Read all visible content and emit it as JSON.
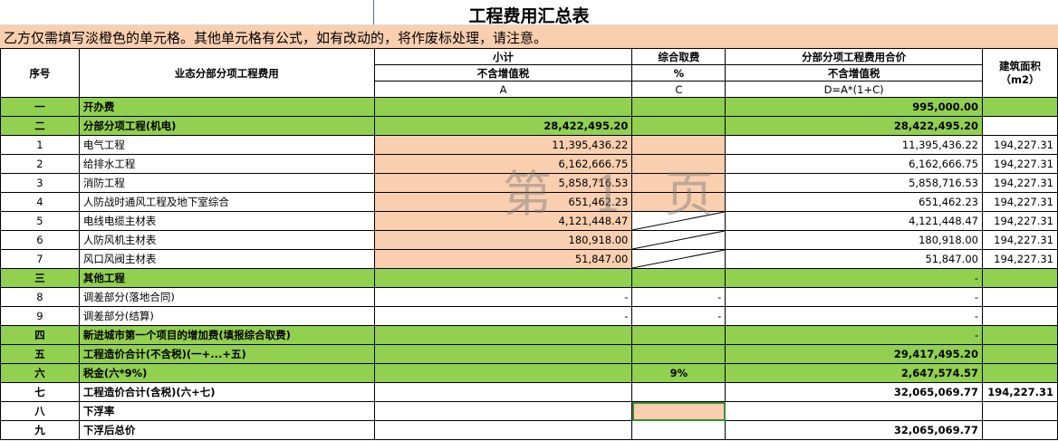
{
  "sheet": {
    "title": "工程费用汇总表",
    "notice": "乙方仅需填写淡橙色的单元格。其他单元格有公式，如有改动的，将作废标处理，请注意。",
    "watermark": "第 1 页"
  },
  "header": {
    "col_no": "序号",
    "col_name": "业态分部分项工程费用",
    "col_subtotal": "小计",
    "col_subtotal_sub": "不含增值税",
    "col_subtotal_letter": "A",
    "col_fee": "综合取费",
    "col_fee_unit": "%",
    "col_fee_letter": "C",
    "col_total": "分部分项工程费用合价",
    "col_total_sub": "不含增值税",
    "col_total_formula": "D=A*(1+C)",
    "col_area": "建筑面积",
    "col_area_unit": "（m2）"
  },
  "rows": [
    {
      "no": "一",
      "name": "开办费",
      "a": "",
      "c": "",
      "d": "995,000.00",
      "area": ""
    },
    {
      "no": "二",
      "name": "分部分项工程(机电)",
      "a": "28,422,495.20",
      "c": "",
      "d": "28,422,495.20",
      "area": ""
    },
    {
      "no": "1",
      "name": "电气工程",
      "a": "11,395,436.22",
      "c": "",
      "d": "11,395,436.22",
      "area": "194,227.31"
    },
    {
      "no": "2",
      "name": "给排水工程",
      "a": "6,162,666.75",
      "c": "",
      "d": "6,162,666.75",
      "area": "194,227.31"
    },
    {
      "no": "3",
      "name": "消防工程",
      "a": "5,858,716.53",
      "c": "",
      "d": "5,858,716.53",
      "area": "194,227.31"
    },
    {
      "no": "4",
      "name": "人防战时通风工程及地下室综合",
      "a": "651,462.23",
      "c": "",
      "d": "651,462.23",
      "area": "194,227.31"
    },
    {
      "no": "5",
      "name": "电线电缆主材表",
      "a": "4,121,448.47",
      "c": "",
      "d": "4,121,448.47",
      "area": "194,227.31"
    },
    {
      "no": "6",
      "name": "人防风机主材表",
      "a": "180,918.00",
      "c": "",
      "d": "180,918.00",
      "area": "194,227.31"
    },
    {
      "no": "7",
      "name": "风口风阀主材表",
      "a": "51,847.00",
      "c": "",
      "d": "51,847.00",
      "area": "194,227.31"
    },
    {
      "no": "三",
      "name": "其他工程",
      "a": "",
      "c": "",
      "d": "-",
      "area": ""
    },
    {
      "no": "8",
      "name": "调差部分(落地合同)",
      "a": "-",
      "c": "-",
      "d": "-",
      "area": ""
    },
    {
      "no": "9",
      "name": "调差部分(结算)",
      "a": "-",
      "c": "-",
      "d": "-",
      "area": ""
    },
    {
      "no": "四",
      "name": "新进城市第一个项目的增加费(填报综合取费)",
      "a": "",
      "c": "",
      "d": "-",
      "area": ""
    },
    {
      "no": "五",
      "name": "工程造价合计(不含税)(一+...+五)",
      "a": "",
      "c": "",
      "d": "29,417,495.20",
      "area": ""
    },
    {
      "no": "六",
      "name": "税金(六*9%)",
      "a": "",
      "c": "9%",
      "d": "2,647,574.57",
      "area": ""
    },
    {
      "no": "七",
      "name": "工程造价合计(含税)(六+七)",
      "a": "",
      "c": "",
      "d": "32,065,069.77",
      "area": "194,227.31"
    },
    {
      "no": "八",
      "name": "下浮率",
      "a": "",
      "c": "",
      "d": "",
      "area": ""
    },
    {
      "no": "九",
      "name": "下浮后总价",
      "a": "",
      "c": "",
      "d": "32,065,069.77",
      "area": ""
    }
  ],
  "colors": {
    "green": "#92d050",
    "orange": "#f9cfaf"
  }
}
